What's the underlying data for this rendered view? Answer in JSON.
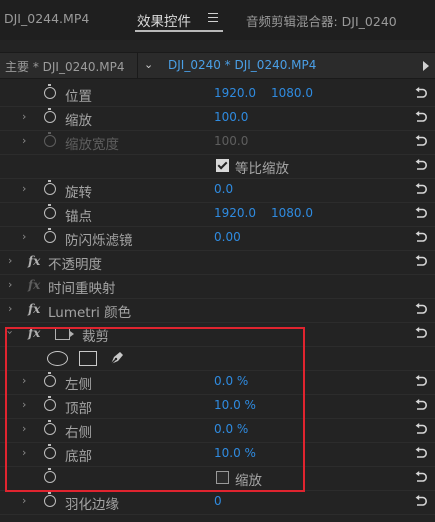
{
  "tabs": [
    {
      "label": "DJI_0244.MP4",
      "active": false
    },
    {
      "label": "效果控件",
      "active": true
    },
    {
      "label": "音频剪辑混合器: DJI_0240",
      "active": false
    }
  ],
  "source_bar": {
    "main_label": "主要 * DJI_0240.MP4",
    "sequence_label": "DJI_0240 * DJI_0240.MP4"
  },
  "properties": {
    "position": {
      "label": "位置",
      "x": "1920.0",
      "y": "1080.0"
    },
    "scale": {
      "label": "缩放",
      "value": "100.0"
    },
    "scale_width": {
      "label": "缩放宽度",
      "value": "100.0"
    },
    "uniform_scale": {
      "label": "等比缩放",
      "checked": true
    },
    "rotation": {
      "label": "旋转",
      "value": "0.0"
    },
    "anchor": {
      "label": "锚点",
      "x": "1920.0",
      "y": "1080.0"
    },
    "anti_flicker": {
      "label": "防闪烁滤镜",
      "value": "0.00"
    }
  },
  "effects": {
    "opacity": {
      "label": "不透明度"
    },
    "time_remap": {
      "label": "时间重映射"
    },
    "lumetri": {
      "label": "Lumetri 颜色"
    },
    "crop": {
      "label": "裁剪",
      "left": {
        "label": "左侧",
        "value": "0.0 %"
      },
      "top": {
        "label": "顶部",
        "value": "10.0 %"
      },
      "right": {
        "label": "右侧",
        "value": "0.0 %"
      },
      "bottom": {
        "label": "底部",
        "value": "10.0 %"
      },
      "zoom": {
        "label": "缩放",
        "checked": false
      },
      "feather": {
        "label": "羽化边缘",
        "value": "0"
      }
    }
  },
  "colors": {
    "value_blue": "#2f8be0",
    "highlight_red": "#e0242f"
  }
}
